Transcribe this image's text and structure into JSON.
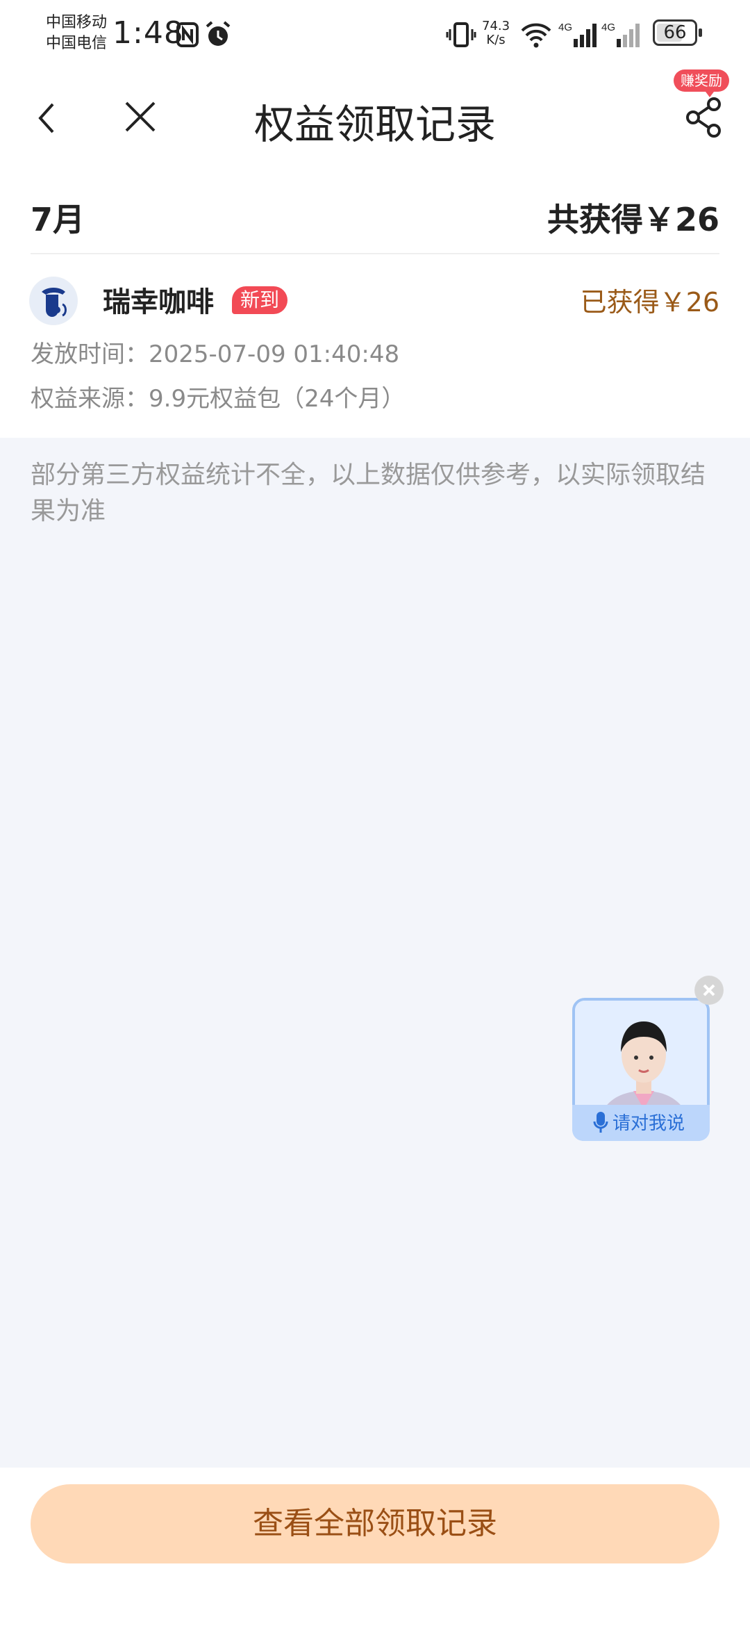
{
  "status_bar": {
    "carrier_1": "中国移动",
    "carrier_2": "中国电信",
    "time": "1:48",
    "net_speed_value": "74.3",
    "net_speed_unit": "K/s",
    "signal_1": "4G",
    "signal_2": "4G",
    "battery": "66",
    "icons": [
      "nfc-icon",
      "alarm-icon",
      "vibrate-icon",
      "wifi-icon",
      "signal-icon",
      "signal-icon",
      "battery-icon"
    ]
  },
  "header": {
    "title": "权益领取记录",
    "reward_badge": "赚奖励"
  },
  "summary": {
    "month": "7月",
    "total": "共获得￥26"
  },
  "record": {
    "brand": "瑞幸咖啡",
    "badge": "新到",
    "earned": "已获得￥26",
    "time": "发放时间：2025-07-09 01:40:48",
    "source": "权益来源：9.9元权益包（24个月）"
  },
  "note": "部分第三方权益统计不全，以上数据仅供参考，以实际领取结果为准",
  "assistant": {
    "speak_label": "请对我说"
  },
  "footer": {
    "cta": "查看全部领取记录"
  },
  "colors": {
    "accent_orange": "#9a4f15",
    "cta_bg": "#ffd9b7",
    "badge_red": "#f24a55",
    "page_bg": "#f3f5fa"
  }
}
